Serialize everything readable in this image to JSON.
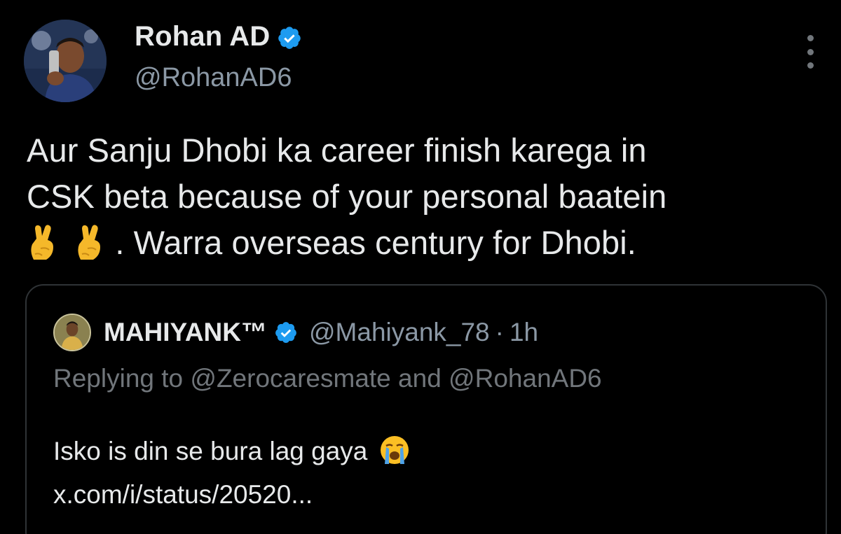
{
  "author": {
    "display_name": "Rohan AD",
    "handle": "@RohanAD6",
    "verified": true,
    "avatar_icon": "profile-avatar-cricketer"
  },
  "tweet": {
    "line1": "Aur Sanju Dhobi ka career finish karega in",
    "line2": "CSK beta because of your personal baatein",
    "line3_prefix_emojis": [
      "crossed-fingers-emoji",
      "crossed-fingers-emoji"
    ],
    "line3_text": ". Warra overseas century for Dhobi."
  },
  "menu": {
    "icon": "more-vertical-icon"
  },
  "quote": {
    "display_name": "MAHIYANK™",
    "verified": true,
    "handle": "@Mahiyank_78",
    "separator": "·",
    "time": "1h",
    "replying_to": "Replying to @Zerocaresmate and @RohanAD6",
    "body_text": "Isko is din se bura lag gaya",
    "body_emoji": "loudly-crying-face-emoji",
    "link": "x.com/i/status/20520..."
  },
  "colors": {
    "background": "#000000",
    "text_primary": "#e7e9ea",
    "text_secondary": "#8b98a5",
    "verified_blue": "#1d9bf0",
    "border": "#2f3336",
    "emoji_yellow": "#fbbf24"
  }
}
